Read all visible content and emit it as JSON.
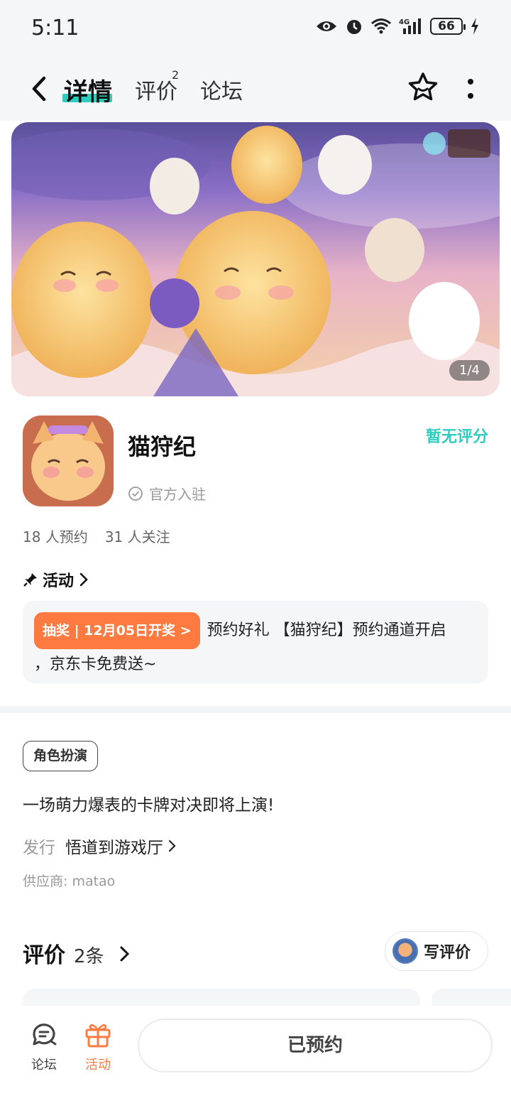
{
  "status_bar": {
    "time": "5:11",
    "battery": "66"
  },
  "nav": {
    "tabs": [
      {
        "label": "详情"
      },
      {
        "label": "评价"
      },
      {
        "label": "论坛"
      }
    ],
    "review_count_sup": "2"
  },
  "banner": {
    "counter": "1/4"
  },
  "app": {
    "name": "猫狩纪",
    "official_label": "官方入驻",
    "rating": "暂无评分",
    "reservations": "18 人预约",
    "followers": "31 人关注"
  },
  "activity": {
    "section_title": "活动",
    "badge": "抽奖 | 12月05日开奖 >",
    "text_line1": "预约好礼 【猫狩纪】预约通道开启",
    "text_line2": "，京东卡免费送~"
  },
  "info": {
    "genre_tag": "角色扮演",
    "description": "一场萌力爆表的卡牌对决即将上演!",
    "publisher_label": "发行",
    "publisher_name": "悟道到游戏厅",
    "supplier": "供应商: matao"
  },
  "reviews": {
    "title": "评价",
    "count": "2条",
    "write_button": "写评价"
  },
  "bottom_bar": {
    "forum_label": "论坛",
    "activity_label": "活动",
    "reserve_button": "已预约"
  },
  "colors": {
    "accent": "#2ccfbf",
    "orange": "#ff7a40"
  }
}
